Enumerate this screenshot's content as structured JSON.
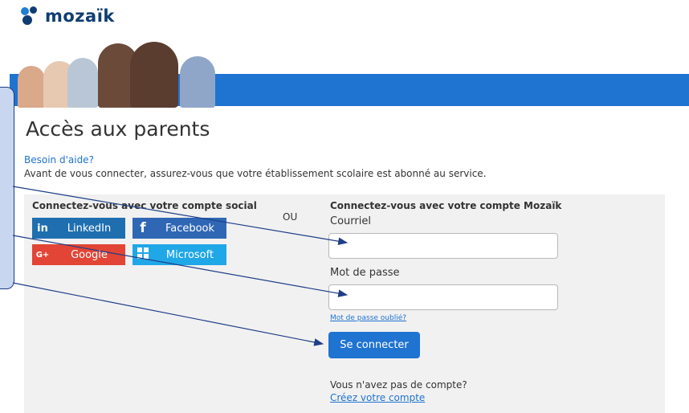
{
  "brand": {
    "name": "mozaïk"
  },
  "page": {
    "title": "Accès aux parents",
    "help_link": "Besoin d'aide?",
    "intro": "Avant de vous connecter, assurez-vous que votre établissement scolaire est abonné au service."
  },
  "social": {
    "title": "Connectez-vous avec votre compte social",
    "buttons": [
      {
        "label": "LinkedIn",
        "icon": "in",
        "color": "#1f6fb0"
      },
      {
        "label": "Facebook",
        "icon": "f",
        "color": "#2f67b5"
      },
      {
        "label": "Google",
        "icon": "G+",
        "color": "#e24536"
      },
      {
        "label": "Microsoft",
        "icon": "windows-icon",
        "color": "#20a7e8"
      }
    ]
  },
  "separator": "OU",
  "login": {
    "title": "Connectez-vous avec votre compte Mozaïk",
    "email_label": "Courriel",
    "email_value": "",
    "password_label": "Mot de passe",
    "password_value": "",
    "forgot_link": "Mot de passe oublié?",
    "submit": "Se connecter",
    "no_account": "Vous n'avez pas de compte?",
    "create_link": "Créez votre compte"
  },
  "colors": {
    "accent": "#1f73d1",
    "brand_dark": "#0f3d73",
    "panel": "#f1f1f1",
    "callout": "#c8d7ef"
  }
}
